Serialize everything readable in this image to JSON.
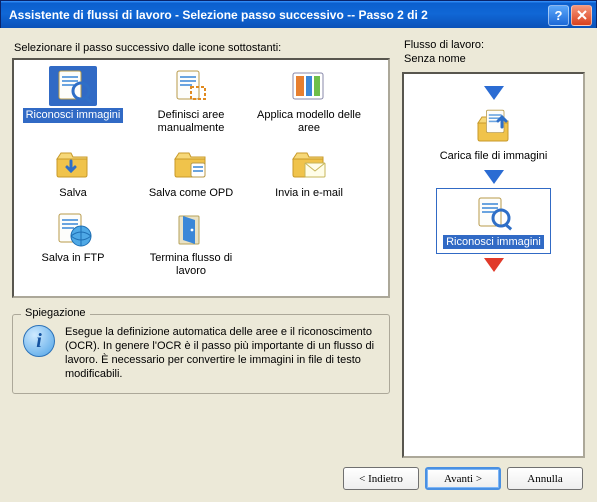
{
  "window": {
    "title": "Assistente di flussi di lavoro - Selezione passo successivo -- Passo 2 di 2"
  },
  "left": {
    "prompt": "Selezionare il passo successivo dalle icone sottostanti:",
    "steps": [
      {
        "id": "riconosci-immagini",
        "label": "Riconosci immagini",
        "icon": "ocr-icon",
        "selected": true
      },
      {
        "id": "definisci-aree",
        "label": "Definisci aree manualmente",
        "icon": "zones-icon"
      },
      {
        "id": "applica-modello",
        "label": "Applica modello delle aree",
        "icon": "template-icon"
      },
      {
        "id": "salva",
        "label": "Salva",
        "icon": "save-icon"
      },
      {
        "id": "salva-opd",
        "label": "Salva come OPD",
        "icon": "save-opd-icon"
      },
      {
        "id": "invia-email",
        "label": "Invia in e-mail",
        "icon": "email-icon"
      },
      {
        "id": "salva-ftp",
        "label": "Salva in FTP",
        "icon": "ftp-icon"
      },
      {
        "id": "termina",
        "label": "Termina flusso di lavoro",
        "icon": "exit-icon"
      }
    ]
  },
  "explanation": {
    "legend": "Spiegazione",
    "text": "Esegue la definizione automatica delle aree e il riconoscimento (OCR). In genere l'OCR è il passo più importante di un flusso di lavoro. È necessario per convertire le immagini in file di testo modificabili."
  },
  "workflow": {
    "header_line1": "Flusso di lavoro:",
    "header_line2": "Senza nome",
    "steps": [
      {
        "label": "Carica file di immagini",
        "icon": "load-images-icon",
        "selected": false
      },
      {
        "label": "Riconosci immagini",
        "icon": "ocr-icon",
        "selected": true
      }
    ]
  },
  "buttons": {
    "back": "< Indietro",
    "next": "Avanti >",
    "cancel": "Annulla"
  },
  "colors": {
    "selection": "#316ac5",
    "panel": "#ece9d8"
  }
}
